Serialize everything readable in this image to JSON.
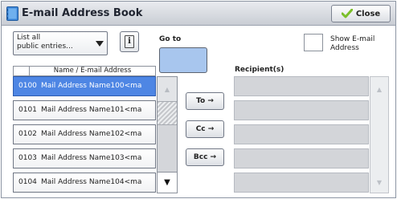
{
  "window": {
    "title": "E-mail Address Book",
    "close_label": "Close"
  },
  "filter": {
    "selected": "List all public entries...",
    "line1": "List all",
    "line2": "public entries..."
  },
  "goto": {
    "label": "Go to"
  },
  "show_email": {
    "label_line1": "Show E-mail",
    "label_line2": "Address",
    "checked": false
  },
  "address_list": {
    "header": "Name / E-mail Address",
    "rows": [
      {
        "num": "0100",
        "name": "Mail Address Name100<ma",
        "selected": true
      },
      {
        "num": "0101",
        "name": "Mail Address Name101<ma",
        "selected": false
      },
      {
        "num": "0102",
        "name": "Mail Address Name102<ma",
        "selected": false
      },
      {
        "num": "0103",
        "name": "Mail Address Name103<ma",
        "selected": false
      },
      {
        "num": "0104",
        "name": "Mail Address Name104<ma",
        "selected": false
      }
    ]
  },
  "route_buttons": {
    "to": "To →",
    "cc": "Cc →",
    "bcc": "Bcc →"
  },
  "recipients": {
    "label": "Recipient(s)",
    "rows": [
      "",
      "",
      "",
      "",
      ""
    ]
  },
  "colors": {
    "selected_row": "#4e86e4",
    "goto_button": "#a8c6ee",
    "close_check": "#7bbf2a"
  },
  "icons": {
    "title": "address-book-icon",
    "close": "checkmark-icon",
    "info": "info-icon",
    "dropdown": "chevron-down-icon",
    "scroll_up": "arrow-up-icon",
    "scroll_down": "arrow-down-icon"
  }
}
